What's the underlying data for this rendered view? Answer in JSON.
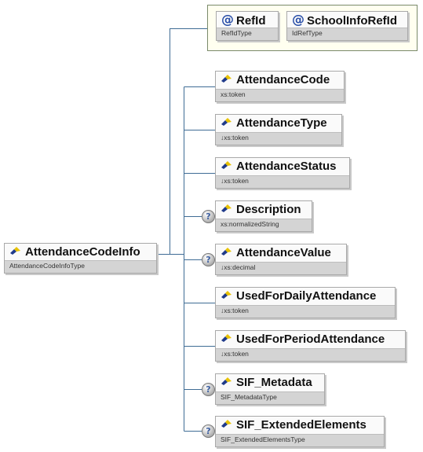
{
  "root": {
    "name": "AttendanceCodeInfo",
    "type": "AttendanceCodeInfoType"
  },
  "attributes": [
    {
      "name": "RefId",
      "type": "RefIdType"
    },
    {
      "name": "SchoolInfoRefId",
      "type": "IdRefType"
    }
  ],
  "elements": [
    {
      "name": "AttendanceCode",
      "type": "xs:token",
      "optional": false
    },
    {
      "name": "AttendanceType",
      "type": "↓xs:token",
      "optional": false
    },
    {
      "name": "AttendanceStatus",
      "type": "↓xs:token",
      "optional": false
    },
    {
      "name": "Description",
      "type": "xs:normalizedString",
      "optional": true
    },
    {
      "name": "AttendanceValue",
      "type": "↓xs:decimal",
      "optional": true
    },
    {
      "name": "UsedForDailyAttendance",
      "type": "↓xs:token",
      "optional": false
    },
    {
      "name": "UsedForPeriodAttendance",
      "type": "↓xs:token",
      "optional": false
    },
    {
      "name": "SIF_Metadata",
      "type": "SIF_MetadataType",
      "optional": true
    },
    {
      "name": "SIF_ExtendedElements",
      "type": "SIF_ExtendedElementsType",
      "optional": true
    }
  ],
  "icons": {
    "element": "element-icon",
    "attribute": "attribute-at-icon",
    "optional": "question-mark-icon"
  },
  "colors": {
    "line": "#3f6c95",
    "attr_border": "#7a8a6a",
    "type_bar": "#d4d4d4",
    "icon_yellow": "#e8c200",
    "icon_blue": "#1f3a8a"
  }
}
